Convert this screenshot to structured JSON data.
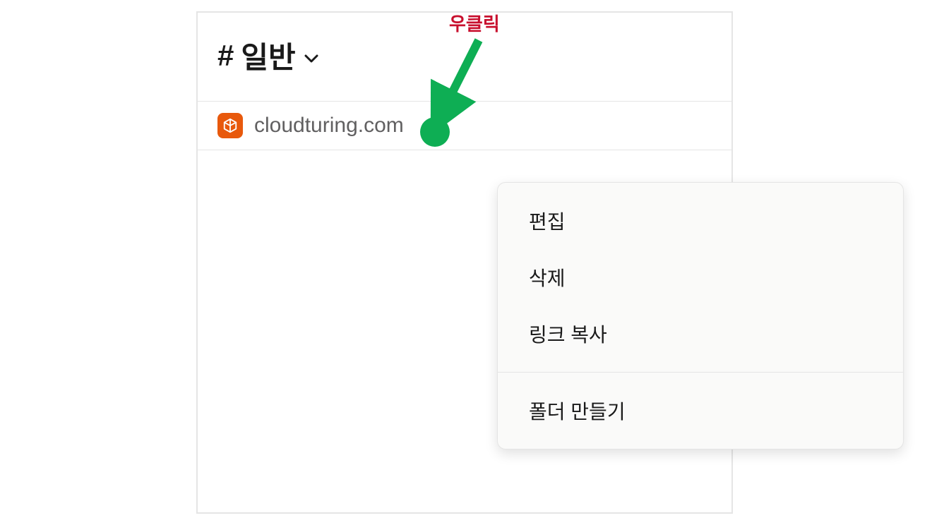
{
  "annotation": {
    "label": "우클릭",
    "dot_color": "#0eae54",
    "arrow_color": "#0eae54",
    "label_color": "#c8102e"
  },
  "channel": {
    "hash": "#",
    "name": "일반"
  },
  "bookmark": {
    "text": "cloudturing.com",
    "add_label": "+"
  },
  "context_menu": {
    "section1": {
      "edit": "편집",
      "delete": "삭제",
      "copy_link": "링크 복사"
    },
    "section2": {
      "create_folder": "폴더 만들기"
    }
  }
}
